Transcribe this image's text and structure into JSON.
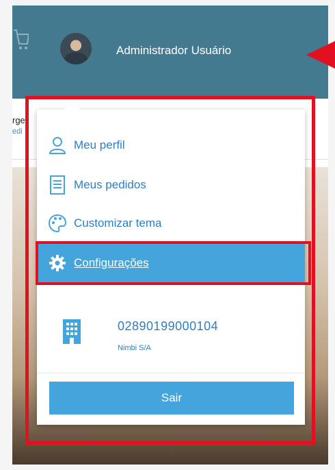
{
  "header": {
    "user_name": "Administrador Usuário"
  },
  "background": {
    "text_a": "rge",
    "text_b": "edi"
  },
  "menu": {
    "items": [
      {
        "label": "Meu perfil",
        "icon": "user-icon"
      },
      {
        "label": "Meus pedidos",
        "icon": "receipt-icon"
      },
      {
        "label": "Customizar tema",
        "icon": "palette-icon"
      },
      {
        "label": "Configurações",
        "icon": "gear-icon",
        "active": true
      }
    ],
    "company": {
      "cnpj": "02890199000104",
      "name": "Nimbi S/A",
      "icon": "building-icon"
    },
    "logout_label": "Sair"
  },
  "colors": {
    "header_bg": "#447a8f",
    "accent": "#43a5db",
    "link": "#2f7dc0",
    "highlight": "#e3101f"
  }
}
